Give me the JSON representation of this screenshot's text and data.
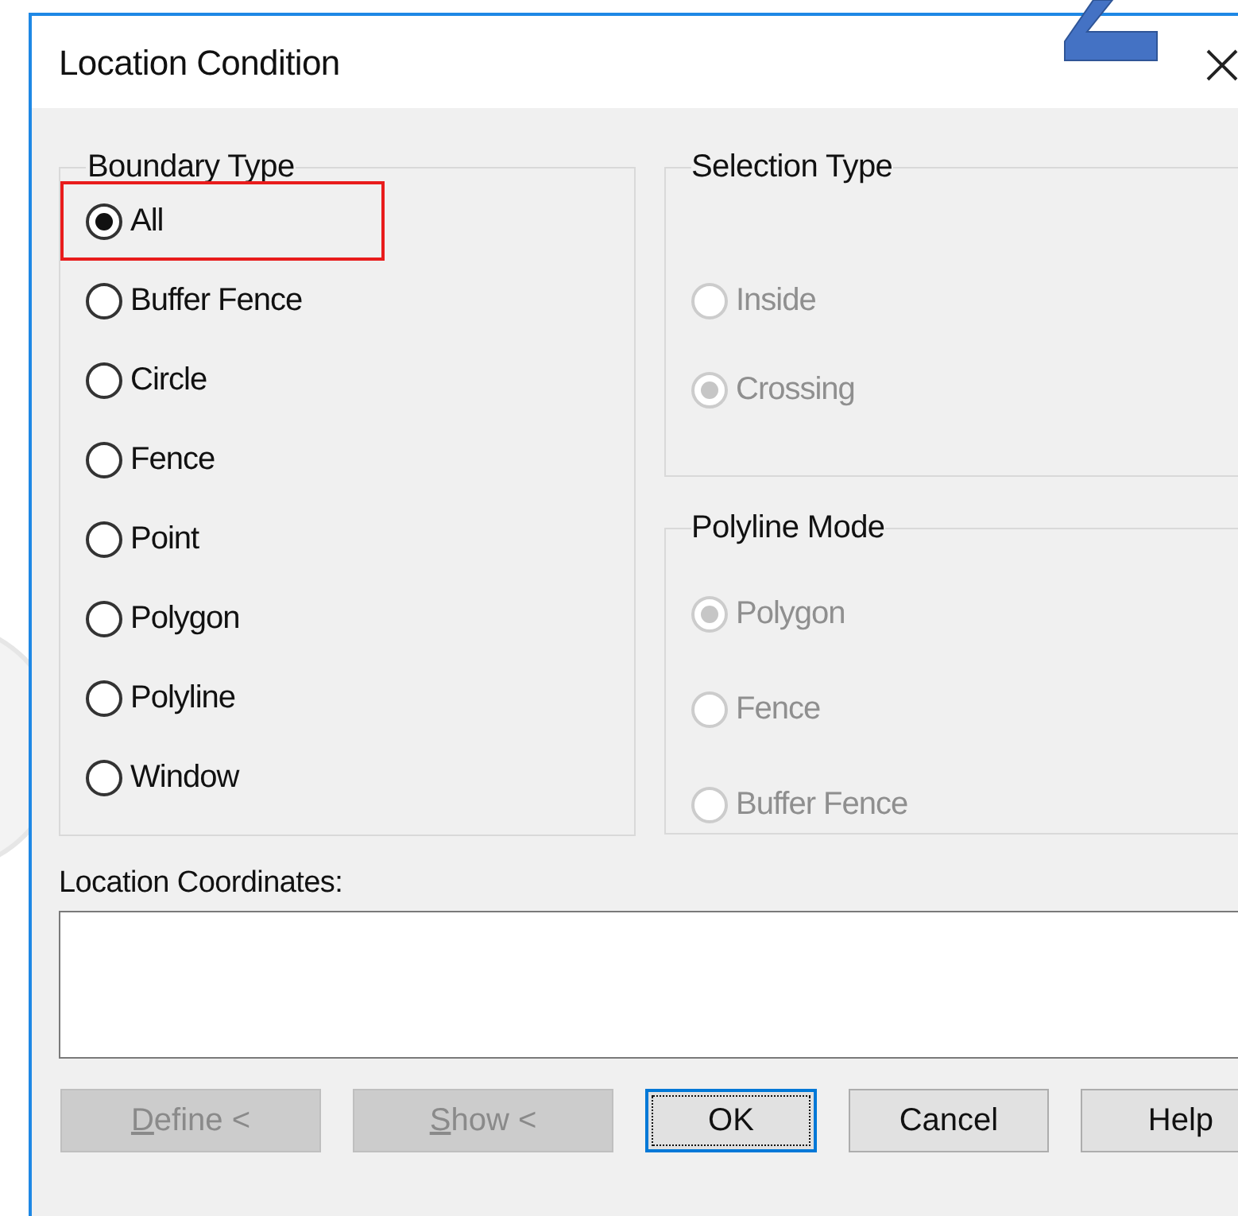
{
  "window": {
    "title": "Location Condition"
  },
  "boundary_type": {
    "legend": "Boundary Type",
    "items": [
      {
        "label": "All",
        "selected": true,
        "highlighted": true
      },
      {
        "label": "Buffer Fence",
        "selected": false,
        "highlighted": false
      },
      {
        "label": "Circle",
        "selected": false,
        "highlighted": false
      },
      {
        "label": "Fence",
        "selected": false,
        "highlighted": false
      },
      {
        "label": "Point",
        "selected": false,
        "highlighted": false
      },
      {
        "label": "Polygon",
        "selected": false,
        "highlighted": false
      },
      {
        "label": "Polyline",
        "selected": false,
        "highlighted": false
      },
      {
        "label": "Window",
        "selected": false,
        "highlighted": false
      }
    ]
  },
  "selection_type": {
    "legend": "Selection Type",
    "disabled": true,
    "items": [
      {
        "label": "Inside",
        "selected": false
      },
      {
        "label": "Crossing",
        "selected": true
      }
    ]
  },
  "polyline_mode": {
    "legend": "Polyline Mode",
    "disabled": true,
    "items": [
      {
        "label": "Polygon",
        "selected": true
      },
      {
        "label": "Fence",
        "selected": false
      },
      {
        "label": "Buffer Fence",
        "selected": false
      }
    ]
  },
  "location_coordinates": {
    "label": "Location Coordinates:"
  },
  "buttons": [
    {
      "label": "Define <",
      "first_letter_underlined": true,
      "disabled": true,
      "default": false
    },
    {
      "label": "Show <",
      "first_letter_underlined": true,
      "disabled": true,
      "default": false
    },
    {
      "label": "OK",
      "disabled": false,
      "default": true
    },
    {
      "label": "Cancel",
      "disabled": false,
      "default": false
    },
    {
      "label": "Help",
      "disabled": false,
      "default": false
    }
  ]
}
